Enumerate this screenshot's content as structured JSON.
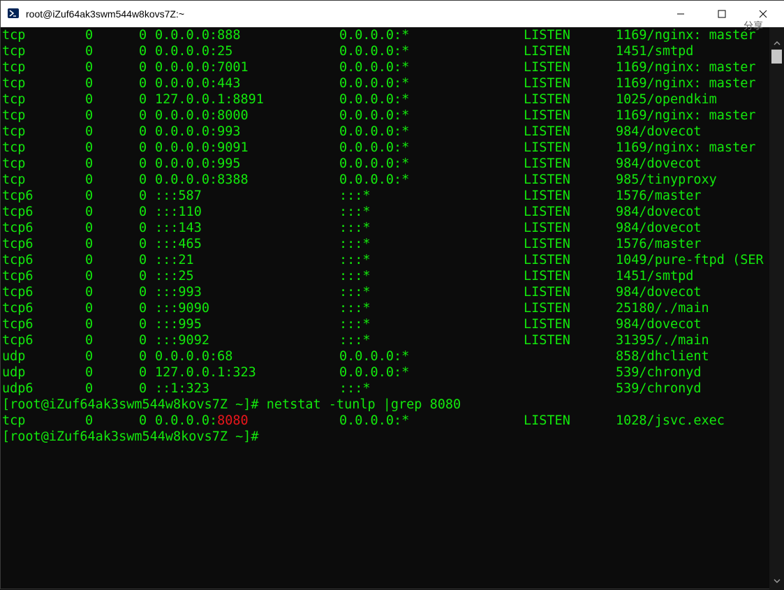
{
  "window": {
    "title": "root@iZuf64ak3swm544w8kovs7Z:~",
    "background_hint": "分享",
    "colors": {
      "text": "#13e80c",
      "highlight": "#e8161b",
      "background": "#0c0c0c"
    }
  },
  "terminal": {
    "rows": [
      {
        "proto": "tcp",
        "recv": "0",
        "send": "0",
        "local": "0.0.0.0:888",
        "foreign": "0.0.0.0:*",
        "state": "LISTEN",
        "pid": "1169/nginx: master"
      },
      {
        "proto": "tcp",
        "recv": "0",
        "send": "0",
        "local": "0.0.0.0:25",
        "foreign": "0.0.0.0:*",
        "state": "LISTEN",
        "pid": "1451/smtpd"
      },
      {
        "proto": "tcp",
        "recv": "0",
        "send": "0",
        "local": "0.0.0.0:7001",
        "foreign": "0.0.0.0:*",
        "state": "LISTEN",
        "pid": "1169/nginx: master"
      },
      {
        "proto": "tcp",
        "recv": "0",
        "send": "0",
        "local": "0.0.0.0:443",
        "foreign": "0.0.0.0:*",
        "state": "LISTEN",
        "pid": "1169/nginx: master"
      },
      {
        "proto": "tcp",
        "recv": "0",
        "send": "0",
        "local": "127.0.0.1:8891",
        "foreign": "0.0.0.0:*",
        "state": "LISTEN",
        "pid": "1025/opendkim"
      },
      {
        "proto": "tcp",
        "recv": "0",
        "send": "0",
        "local": "0.0.0.0:8000",
        "foreign": "0.0.0.0:*",
        "state": "LISTEN",
        "pid": "1169/nginx: master"
      },
      {
        "proto": "tcp",
        "recv": "0",
        "send": "0",
        "local": "0.0.0.0:993",
        "foreign": "0.0.0.0:*",
        "state": "LISTEN",
        "pid": "984/dovecot"
      },
      {
        "proto": "tcp",
        "recv": "0",
        "send": "0",
        "local": "0.0.0.0:9091",
        "foreign": "0.0.0.0:*",
        "state": "LISTEN",
        "pid": "1169/nginx: master"
      },
      {
        "proto": "tcp",
        "recv": "0",
        "send": "0",
        "local": "0.0.0.0:995",
        "foreign": "0.0.0.0:*",
        "state": "LISTEN",
        "pid": "984/dovecot"
      },
      {
        "proto": "tcp",
        "recv": "0",
        "send": "0",
        "local": "0.0.0.0:8388",
        "foreign": "0.0.0.0:*",
        "state": "LISTEN",
        "pid": "985/tinyproxy"
      },
      {
        "proto": "tcp6",
        "recv": "0",
        "send": "0",
        "local": ":::587",
        "foreign": ":::*",
        "state": "LISTEN",
        "pid": "1576/master"
      },
      {
        "proto": "tcp6",
        "recv": "0",
        "send": "0",
        "local": ":::110",
        "foreign": ":::*",
        "state": "LISTEN",
        "pid": "984/dovecot"
      },
      {
        "proto": "tcp6",
        "recv": "0",
        "send": "0",
        "local": ":::143",
        "foreign": ":::*",
        "state": "LISTEN",
        "pid": "984/dovecot"
      },
      {
        "proto": "tcp6",
        "recv": "0",
        "send": "0",
        "local": ":::465",
        "foreign": ":::*",
        "state": "LISTEN",
        "pid": "1576/master"
      },
      {
        "proto": "tcp6",
        "recv": "0",
        "send": "0",
        "local": ":::21",
        "foreign": ":::*",
        "state": "LISTEN",
        "pid": "1049/pure-ftpd (SER"
      },
      {
        "proto": "tcp6",
        "recv": "0",
        "send": "0",
        "local": ":::25",
        "foreign": ":::*",
        "state": "LISTEN",
        "pid": "1451/smtpd"
      },
      {
        "proto": "tcp6",
        "recv": "0",
        "send": "0",
        "local": ":::993",
        "foreign": ":::*",
        "state": "LISTEN",
        "pid": "984/dovecot"
      },
      {
        "proto": "tcp6",
        "recv": "0",
        "send": "0",
        "local": ":::9090",
        "foreign": ":::*",
        "state": "LISTEN",
        "pid": "25180/./main"
      },
      {
        "proto": "tcp6",
        "recv": "0",
        "send": "0",
        "local": ":::995",
        "foreign": ":::*",
        "state": "LISTEN",
        "pid": "984/dovecot"
      },
      {
        "proto": "tcp6",
        "recv": "0",
        "send": "0",
        "local": ":::9092",
        "foreign": ":::*",
        "state": "LISTEN",
        "pid": "31395/./main"
      },
      {
        "proto": "udp",
        "recv": "0",
        "send": "0",
        "local": "0.0.0.0:68",
        "foreign": "0.0.0.0:*",
        "state": "",
        "pid": "858/dhclient"
      },
      {
        "proto": "udp",
        "recv": "0",
        "send": "0",
        "local": "127.0.0.1:323",
        "foreign": "0.0.0.0:*",
        "state": "",
        "pid": "539/chronyd"
      },
      {
        "proto": "udp6",
        "recv": "0",
        "send": "0",
        "local": "::1:323",
        "foreign": ":::*",
        "state": "",
        "pid": "539/chronyd"
      }
    ],
    "command_line": "[root@iZuf64ak3swm544w8kovs7Z ~]# netstat -tunlp |grep 8080",
    "result": {
      "proto": "tcp",
      "recv": "0",
      "send": "0",
      "local_prefix": "0.0.0.0:",
      "local_port": "8080",
      "foreign": "0.0.0.0:*",
      "state": "LISTEN",
      "pid": "1028/jsvc.exec"
    },
    "prompt": "[root@iZuf64ak3swm544w8kovs7Z ~]#"
  }
}
